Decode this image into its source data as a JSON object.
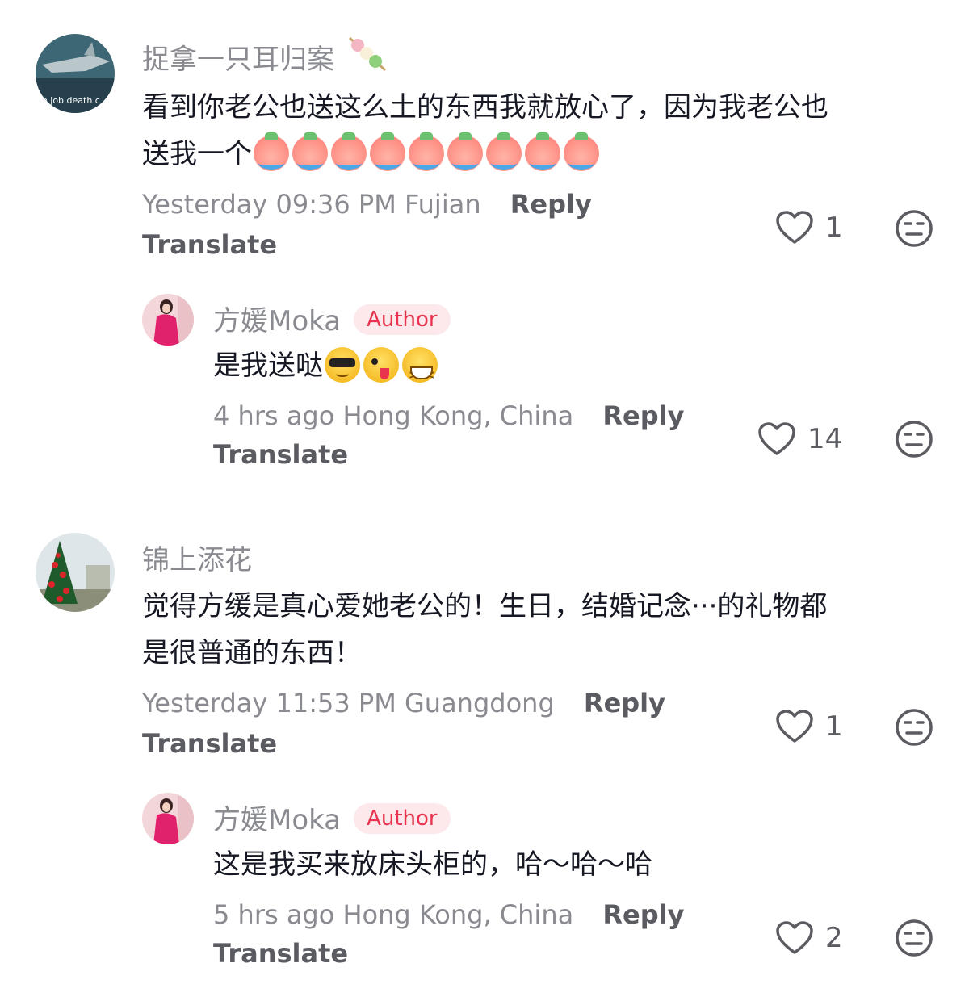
{
  "comments": [
    {
      "username": "捉拿一只耳归案",
      "avatar_text": "e job death c",
      "text_line1": "看到你老公也送这么土的东西我就放心了，因为我老公也",
      "text_line2": "送我一个",
      "time": "Yesterday 09:36 PM",
      "location": "Fujian",
      "reply_label": "Reply",
      "translate_label": "Translate",
      "likes": "1"
    },
    {
      "username": "方媛Moka",
      "badge": "Author",
      "text": "是我送哒",
      "time": "4 hrs ago",
      "location": "Hong Kong, China",
      "reply_label": "Reply",
      "translate_label": "Translate",
      "likes": "14"
    },
    {
      "username": "锦上添花",
      "text_line1": "觉得方缓是真心爱她老公的！生日，结婚记念···的礼物都",
      "text_line2": "是很普通的东西！",
      "time": "Yesterday 11:53 PM",
      "location": "Guangdong",
      "reply_label": "Reply",
      "translate_label": "Translate",
      "likes": "1"
    },
    {
      "username": "方媛Moka",
      "badge": "Author",
      "text": "这是我买来放床头柜的，哈～哈～哈",
      "time": "5 hrs ago",
      "location": "Hong Kong, China",
      "reply_label": "Reply",
      "translate_label": "Translate",
      "likes": "2"
    }
  ],
  "icons": {
    "like": "heart-outline-icon",
    "dislike": "neutral-face-icon",
    "peach_emoji": "crying-peach-emoji",
    "cool_emoji": "sunglasses-emoji",
    "wink_emoji": "winking-tongue-emoji",
    "grin_emoji": "grinning-squint-emoji",
    "tanghulu_emoji": "tanghulu-skewer-emoji"
  },
  "colors": {
    "author_badge_bg": "#fde8ec",
    "author_badge_text": "#e8344e",
    "meta_gray": "#8a8b91"
  }
}
